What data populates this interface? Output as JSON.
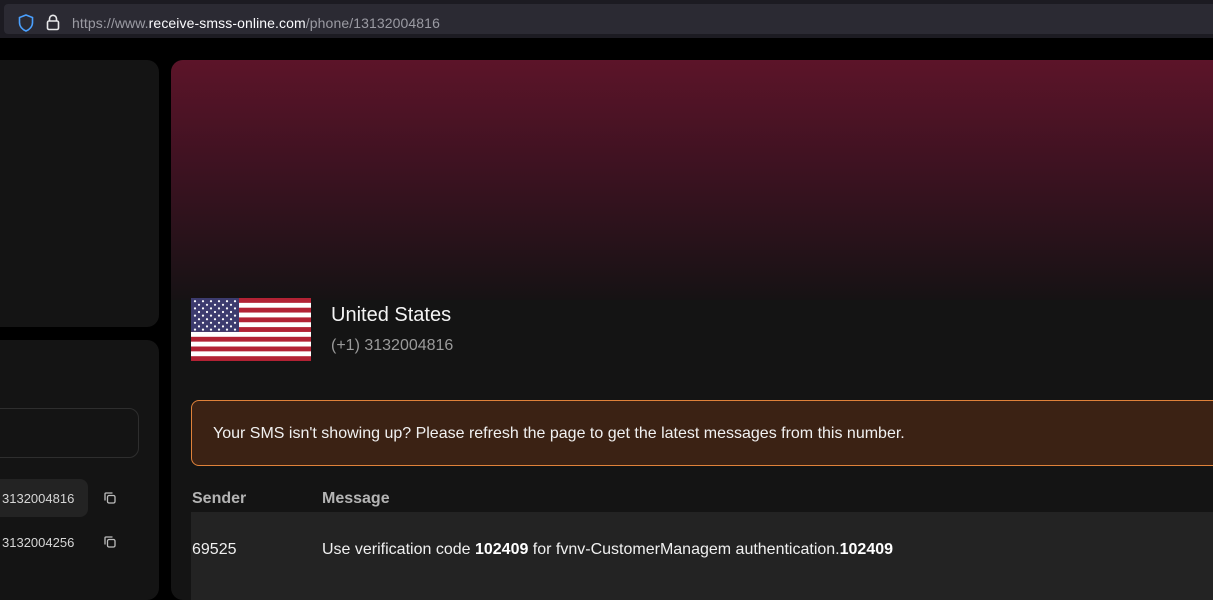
{
  "browser": {
    "url_prefix": "https://www.",
    "url_domain": "receive-smss-online.com",
    "url_path": "/phone/13132004816"
  },
  "sidebar": {
    "numbers": [
      {
        "label": "3132004816",
        "active": true
      },
      {
        "label": "3132004256",
        "active": false
      }
    ]
  },
  "main": {
    "country": "United States",
    "phone": "(+1) 3132004816",
    "notice": "Your SMS isn't showing up? Please refresh the page to get the latest messages from this number.",
    "table": {
      "headers": [
        "Sender",
        "Message"
      ],
      "rows": [
        {
          "sender": "69525",
          "message_parts": [
            {
              "text": "Use verification code ",
              "bold": false
            },
            {
              "text": "102409",
              "bold": true
            },
            {
              "text": " for fvnv-CustomerManagem authentication.",
              "bold": false
            },
            {
              "text": "102409",
              "bold": true
            }
          ]
        }
      ]
    }
  },
  "colors": {
    "accent_gradient_top": "#5c1429",
    "notice_border": "#e0823a",
    "notice_bg": "#3b2214"
  }
}
